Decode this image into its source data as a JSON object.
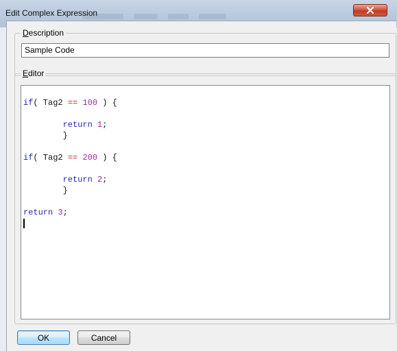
{
  "window": {
    "title": "Edit Complex Expression",
    "close_label": "X"
  },
  "description": {
    "label_accel": "D",
    "label_rest": "escription",
    "value": "Sample Code"
  },
  "editor": {
    "label_accel": "E",
    "label_rest": "ditor"
  },
  "buttons": {
    "ok": "OK",
    "cancel": "Cancel"
  },
  "colors": {
    "keyword": "#1f1fb4",
    "number": "#9a2a9a",
    "operator": "#c02020"
  }
}
